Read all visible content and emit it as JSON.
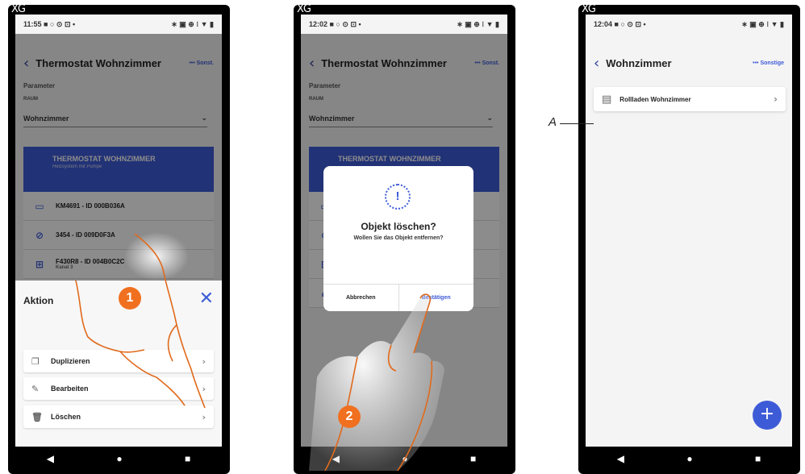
{
  "phone1": {
    "xg": "XG",
    "time": "11:55",
    "status_icons": "■ ○ ⊙ ⊡ •",
    "status_right": "∗ ▣ ⊕ ⁝ ▼ ▮",
    "title": "Thermostat Wohnzimmer",
    "more": "••• Sonst.",
    "parameter": "Parameter",
    "raum": "RAUM",
    "room_value": "Wohnzimmer",
    "card_title": "THERMOSTAT WOHNZIMMER",
    "card_sub": "Heizsystem mit Pumpe",
    "devices": [
      {
        "name": "KM4691 - ID 000B036A",
        "sub": ""
      },
      {
        "name": "3454 - ID 009D0F3A",
        "sub": ""
      },
      {
        "name": "F430R8 - ID 004B0C2C",
        "sub": "Kanal 3"
      }
    ],
    "sheet_title": "Aktion",
    "actions": [
      "Duplizieren",
      "Bearbeiten",
      "Löschen"
    ],
    "step": "1"
  },
  "phone2": {
    "xg": "XG",
    "time": "12:02",
    "title": "Thermostat Wohnzimmer",
    "more": "••• Sonst.",
    "parameter": "Parameter",
    "raum": "RAUM",
    "room_value": "Wohnzimmer",
    "card_title": "THERMOSTAT WOHNZIMMER",
    "dialog_title": "Objekt löschen?",
    "dialog_msg": "Wollen Sie das Objekt entfernen?",
    "cancel": "Abbrechen",
    "confirm": "Bestätigen",
    "step": "2"
  },
  "phone3": {
    "xg": "XG",
    "time": "12:04",
    "title": "Wohnzimmer",
    "more": "••• Sonstige",
    "item": "Rollladen Wohnzimmer",
    "fab": "+"
  },
  "callout": "A",
  "nav": [
    "◀",
    "●",
    "■"
  ],
  "colors": {
    "accent": "#3e5bd7",
    "step": "#f07020"
  }
}
